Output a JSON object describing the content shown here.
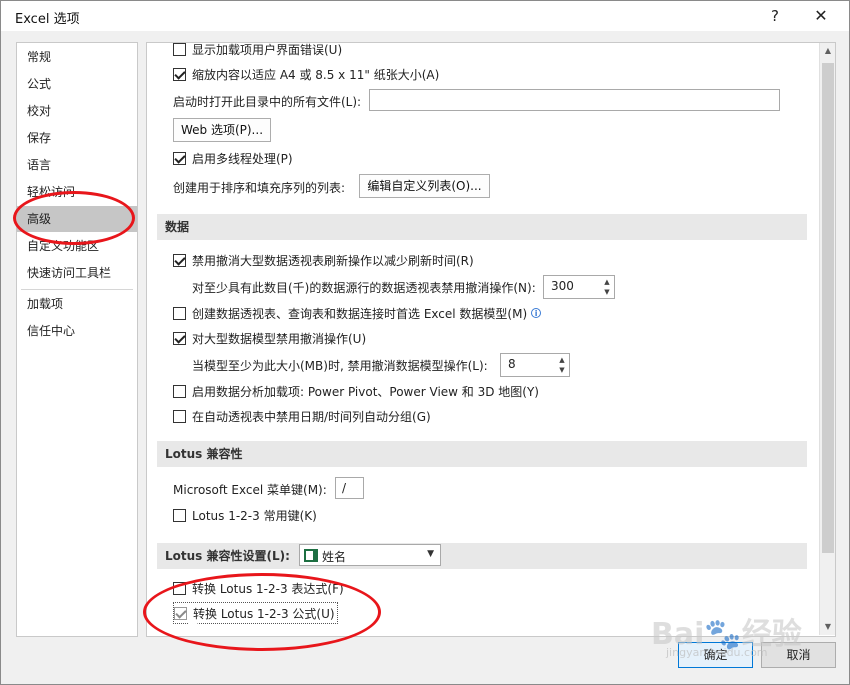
{
  "window": {
    "title": "Excel 选项",
    "help": "?",
    "close": "✕"
  },
  "nav": {
    "items": [
      {
        "label": "常规"
      },
      {
        "label": "公式"
      },
      {
        "label": "校对"
      },
      {
        "label": "保存"
      },
      {
        "label": "语言"
      },
      {
        "label": "轻松访问"
      },
      {
        "label": "高级",
        "selected": true
      },
      {
        "label": "自定义功能区"
      },
      {
        "label": "快速访问工具栏"
      },
      {
        "label": "加载项"
      },
      {
        "label": "信任中心"
      }
    ]
  },
  "general": {
    "show_addin_errors": "显示加载项用户界面错误(U)",
    "scale_a4": "缩放内容以适应 A4 或 8.5 x 11\" 纸张大小(A)",
    "startup_open_label": "启动时打开此目录中的所有文件(L):",
    "startup_open_value": "",
    "web_options_button": "Web 选项(P)...",
    "multithread": "启用多线程处理(P)",
    "custom_list_label": "创建用于排序和填充序列的列表:",
    "edit_custom_list_button": "编辑自定义列表(O)..."
  },
  "data_section": {
    "title": "数据",
    "disable_undo_pivot": "禁用撤消大型数据透视表刷新操作以减少刷新时间(R)",
    "pivot_rows_label": "对至少具有此数目(千)的数据源行的数据透视表禁用撤消操作(N):",
    "pivot_rows_value": "300",
    "prefer_data_model": "创建数据透视表、查询表和数据连接时首选 Excel 数据模型(M)",
    "disable_undo_model": "对大型数据模型禁用撤消操作(U)",
    "model_size_label": "当模型至少为此大小(MB)时, 禁用撤消数据模型操作(L):",
    "model_size_value": "8",
    "enable_addins": "启用数据分析加载项: Power Pivot、Power View 和 3D 地图(Y)",
    "disable_auto_group": "在自动透视表中禁用日期/时间列自动分组(G)"
  },
  "lotus_section": {
    "title": "Lotus 兼容性",
    "menu_key_label": "Microsoft Excel 菜单键(M):",
    "menu_key_value": "/",
    "nav_keys": "Lotus 1-2-3 常用键(K)"
  },
  "lotus_settings": {
    "title": "Lotus 兼容性设置(L):",
    "sheet_value": "姓名",
    "transition_expr": "转换 Lotus 1-2-3 表达式(F)",
    "transition_formula": "转换 Lotus 1-2-3 公式(U)"
  },
  "footer": {
    "ok": "确定",
    "cancel": "取消"
  },
  "watermark": {
    "main": "Bai🐾经验",
    "sub": "jingyan.baidu.com"
  },
  "colors": {
    "annotation": "#e8161b",
    "selected_nav": "#c6c6c6",
    "ok_border": "#0078d7"
  }
}
